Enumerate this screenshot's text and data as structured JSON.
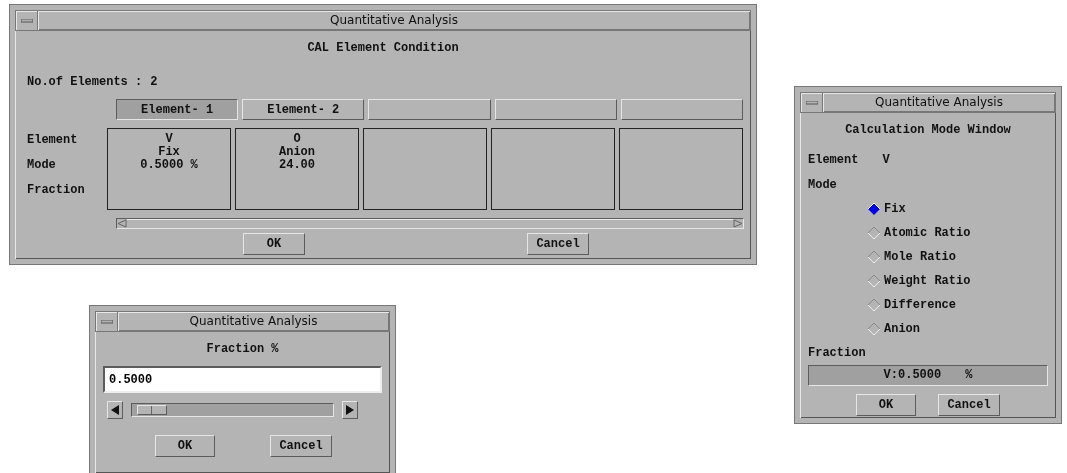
{
  "windows": [
    {
      "kind": "conditions",
      "title": "Quantitative Analysis",
      "heading": "CAL Element Condition",
      "count_label": "No.of Elements :",
      "count": "2",
      "row_labels": [
        "Element",
        "Mode",
        "Fraction"
      ],
      "tabs": [
        {
          "label": "Element- 1",
          "selected": true,
          "cell": [
            "V",
            "Fix",
            "0.5000 %"
          ]
        },
        {
          "label": "Element- 2",
          "selected": false,
          "cell": [
            "O",
            "Anion",
            "24.00"
          ]
        },
        {
          "selected": false
        },
        {
          "selected": false
        },
        {
          "selected": false
        }
      ],
      "buttons": [
        "OK",
        "Cancel"
      ]
    },
    {
      "kind": "mode",
      "title": "Quantitative Analysis",
      "heading": "Calculation Mode Window",
      "element_label": "Element",
      "element_value": "V",
      "mode_label": "Mode",
      "options": [
        {
          "label": "Fix",
          "selected": true
        },
        {
          "label": "Atomic Ratio",
          "selected": false
        },
        {
          "label": "Mole Ratio",
          "selected": false
        },
        {
          "label": "Weight Ratio",
          "selected": false
        },
        {
          "label": "Difference",
          "selected": false
        },
        {
          "label": "Anion",
          "selected": false
        }
      ],
      "fraction_label": "Fraction",
      "fraction_value": "V:0.5000",
      "fraction_unit": "%",
      "buttons": [
        "OK",
        "Cancel"
      ]
    },
    {
      "kind": "fraction",
      "title": "Quantitative Analysis",
      "heading": "Fraction %",
      "value": "0.5000",
      "slider": {
        "level": 0.02
      },
      "buttons": [
        "OK",
        "Cancel"
      ]
    }
  ]
}
